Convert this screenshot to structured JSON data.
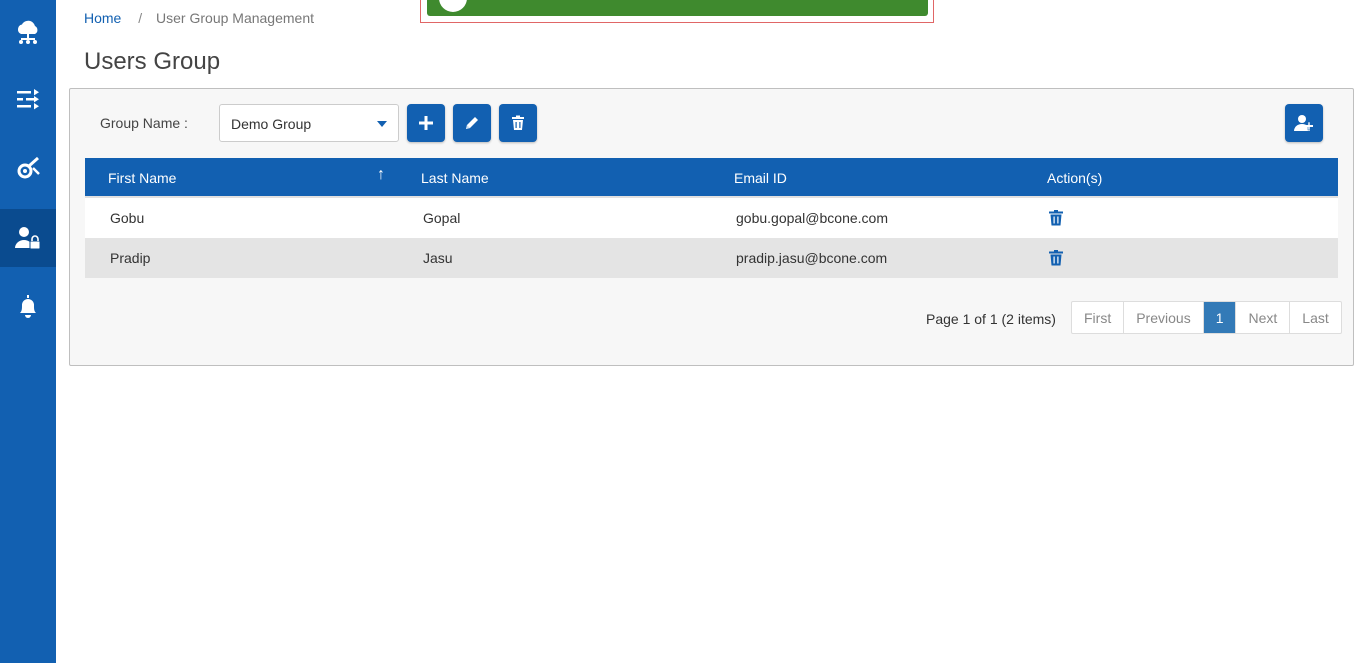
{
  "breadcrumb": {
    "home": "Home",
    "separator": "/",
    "current": "User Group Management"
  },
  "page_title": "Users Group",
  "sidebar": {
    "items": [
      {
        "icon": "cloud-network-icon",
        "active": false
      },
      {
        "icon": "workflow-icon",
        "active": false
      },
      {
        "icon": "settings-tools-icon",
        "active": false
      },
      {
        "icon": "user-lock-icon",
        "active": true
      },
      {
        "icon": "bell-icon",
        "active": false
      }
    ]
  },
  "toolbar": {
    "group_label": "Group Name :",
    "group_selected": "Demo Group",
    "add_icon": "plus-icon",
    "edit_icon": "pencil-icon",
    "delete_icon": "trash-icon",
    "add_user_icon": "user-plus-icon"
  },
  "table": {
    "columns": [
      "First Name",
      "Last Name",
      "Email ID",
      "Action(s)"
    ],
    "sort_indicator": "↑",
    "rows": [
      {
        "first": "Gobu",
        "last": "Gopal",
        "email": "gobu.gopal@bcone.com"
      },
      {
        "first": "Pradip",
        "last": "Jasu",
        "email": "pradip.jasu@bcone.com"
      }
    ]
  },
  "pagination": {
    "info": "Page 1 of 1 (2 items)",
    "first": "First",
    "previous": "Previous",
    "current": "1",
    "next": "Next",
    "last": "Last"
  },
  "colors": {
    "primary": "#1260b1",
    "sidebar_active": "#0a4b8f",
    "toast": "#3f8a2e",
    "pager_active": "#337ab7"
  }
}
